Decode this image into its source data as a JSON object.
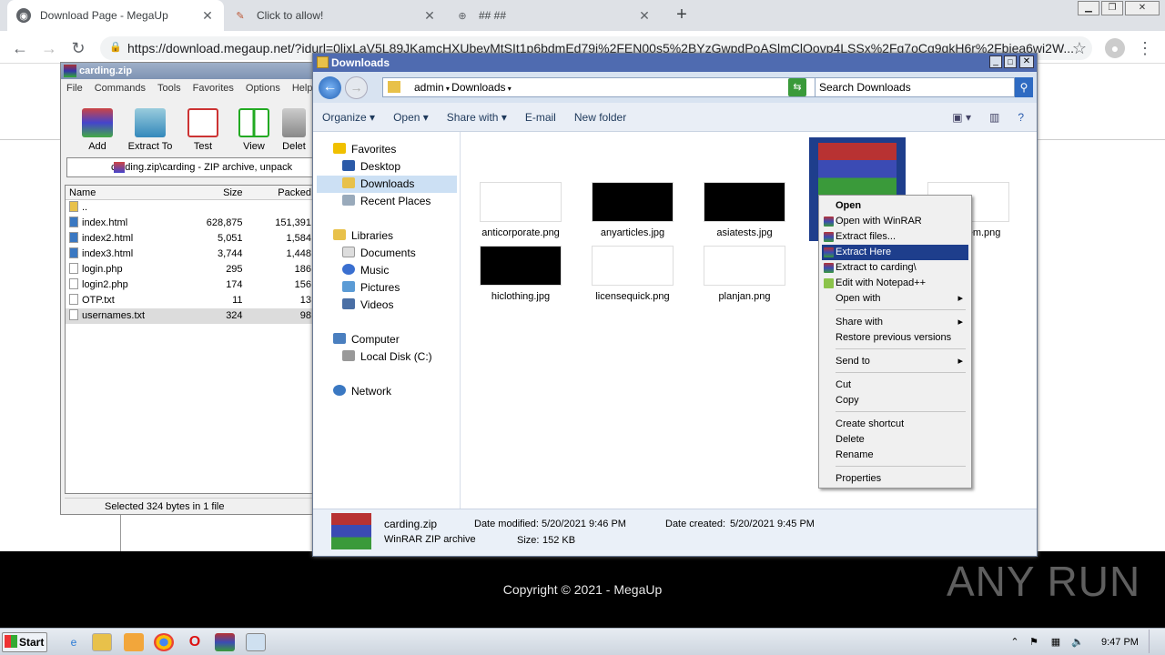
{
  "browser": {
    "tabs": [
      {
        "title": "Download Page - MegaUp",
        "icon": "chrome-page-icon"
      },
      {
        "title": "Click to allow!",
        "icon": "pin-icon"
      },
      {
        "title": "## ##",
        "icon": "globe-icon"
      }
    ],
    "new_tab": "+",
    "url": "https://download.megaup.net/?idurl=0lixLaV5L89JKamcHXUbevMtSIt1p6bdmEd79i%2FEN00s5%2BYzGwpdPoASlmClOovp4LSSx%2Fq7oCq9qkH6r%2Fbiea6wi2W...",
    "copyright": "Copyright © 2021 - MegaUp",
    "watermark": "ANY RUN"
  },
  "winrar": {
    "title": "carding.zip",
    "menu": [
      "File",
      "Commands",
      "Tools",
      "Favorites",
      "Options",
      "Help"
    ],
    "toolbar": [
      "Add",
      "Extract To",
      "Test",
      "View",
      "Delet"
    ],
    "path": "carding.zip\\carding - ZIP archive, unpack",
    "columns": [
      "Name",
      "Size",
      "Packed"
    ],
    "files": [
      {
        "name": "..",
        "size": "",
        "packed": ""
      },
      {
        "name": "index.html",
        "size": "628,875",
        "packed": "151,391"
      },
      {
        "name": "index2.html",
        "size": "5,051",
        "packed": "1,584"
      },
      {
        "name": "index3.html",
        "size": "3,744",
        "packed": "1,448"
      },
      {
        "name": "login.php",
        "size": "295",
        "packed": "186"
      },
      {
        "name": "login2.php",
        "size": "174",
        "packed": "156"
      },
      {
        "name": "OTP.txt",
        "size": "11",
        "packed": "13"
      },
      {
        "name": "usernames.txt",
        "size": "324",
        "packed": "98"
      }
    ],
    "status": "Selected 324 bytes in 1 file"
  },
  "explorer": {
    "title": "Downloads",
    "breadcrumb": [
      "admin",
      "Downloads"
    ],
    "search_placeholder": "Search Downloads",
    "commands": [
      "Organize",
      "Open",
      "Share with",
      "E-mail",
      "New folder"
    ],
    "nav": {
      "favorites": "Favorites",
      "desktop": "Desktop",
      "downloads": "Downloads",
      "recent": "Recent Places",
      "libraries": "Libraries",
      "documents": "Documents",
      "music": "Music",
      "pictures": "Pictures",
      "videos": "Videos",
      "computer": "Computer",
      "localdisk": "Local Disk (C:)",
      "network": "Network"
    },
    "files": [
      {
        "name": "anticorporate.png",
        "thumb": "light"
      },
      {
        "name": "anyarticles.jpg",
        "thumb": "dark"
      },
      {
        "name": "asiatests.jpg",
        "thumb": "dark"
      },
      {
        "name": "carding.zip",
        "thumb": "rar"
      },
      {
        "name": "hem.png",
        "thumb": "light"
      },
      {
        "name": "hiclothing.jpg",
        "thumb": "dark"
      },
      {
        "name": "licensequick.png",
        "thumb": "light"
      },
      {
        "name": "planjan.png",
        "thumb": "light"
      }
    ],
    "details": {
      "name": "carding.zip",
      "type": "WinRAR ZIP archive",
      "modified_label": "Date modified:",
      "modified": "5/20/2021 9:46 PM",
      "created_label": "Date created:",
      "created": "5/20/2021 9:45 PM",
      "size_label": "Size:",
      "size": "152 KB"
    }
  },
  "context_menu": [
    "Open",
    "Open with WinRAR",
    "Extract files...",
    "Extract Here",
    "Extract to carding\\",
    "Edit with Notepad++",
    "Open with",
    "Share with",
    "Restore previous versions",
    "Send to",
    "Cut",
    "Copy",
    "Create shortcut",
    "Delete",
    "Rename",
    "Properties"
  ],
  "taskbar": {
    "start": "Start",
    "clock": "9:47 PM"
  },
  "colors": {
    "highlight": "#1e3e8c",
    "title_blue": "#4f6bb0",
    "footer_bg": "#000000"
  }
}
